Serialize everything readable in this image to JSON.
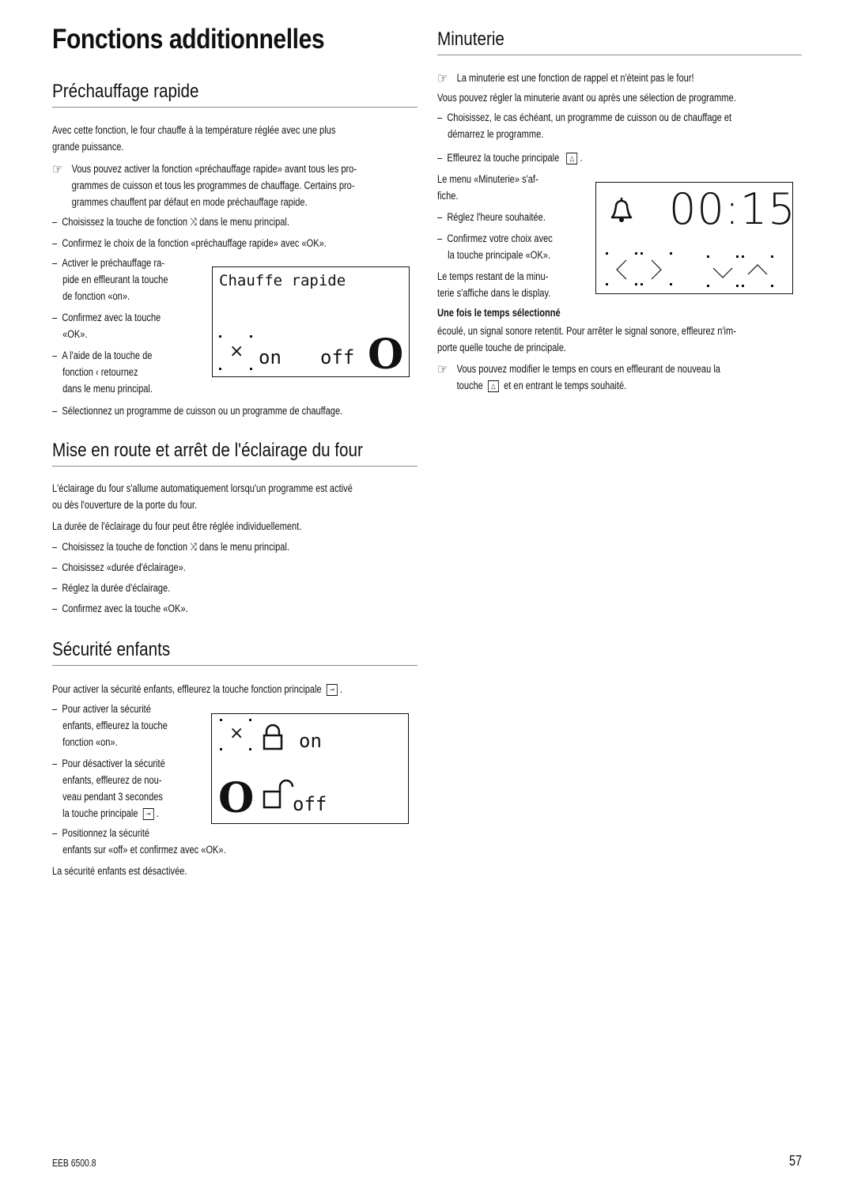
{
  "page": {
    "title": "Fonctions additionnelles",
    "footer_model": "EEB 6500.8",
    "page_number": "57"
  },
  "prechauffage": {
    "heading": "Préchauffage rapide",
    "intro": [
      "Avec cette fonction, le four chauffe à la température réglée avec une plus",
      "grande puissance."
    ],
    "note": [
      "Vous pouvez activer la fonction «préchauffage rapide» avant tous les pro-",
      "grammes de cuisson et tous les programmes de chauffage. Certains pro-",
      "grammes chauffent par défaut en mode préchauffage rapide."
    ],
    "steps": [
      "Choisissez la touche de fonction  ⤨  dans le menu principal.",
      "Confirmez le choix de la fonction «préchauffage rapide» avec «OK»."
    ],
    "steps_narrow": [
      [
        "Activer le préchauffage ra-",
        "pide en effleurant la touche",
        "de fonction «on»."
      ],
      [
        "Confirmez avec la touche",
        "«OK»."
      ],
      [
        "A l'aide de la touche de",
        "fonction  ‹  retournez",
        "dans le menu principal."
      ]
    ],
    "step_last": "Sélectionnez un programme de cuisson ou un programme de chauffage.",
    "lcd": {
      "label": "Chauffe rapide",
      "on": "on",
      "off": "off",
      "state": "O"
    }
  },
  "eclairage": {
    "heading": "Mise en route et arrêt de l'éclairage du four",
    "intro": [
      "L'éclairage du four s'allume automatiquement lorsqu'un programme est activé",
      "ou dès l'ouverture de la porte du four."
    ],
    "duration": "La durée de l'éclairage du four peut être réglée individuellement.",
    "steps": [
      "Choisissez la touche de fonction  ⤨  dans le menu principal.",
      "Choisissez «durée d'éclairage».",
      "Réglez la durée d'éclairage.",
      "Confirmez avec la touche «OK»."
    ]
  },
  "securite": {
    "heading": "Sécurité enfants",
    "intro": "Pour activer la sécurité enfants, effleurez la touche fonction principale",
    "steps": [
      [
        "Pour activer la sécurité",
        "enfants, effleurez la touche",
        "fonction «on»."
      ],
      [
        "Pour désactiver la sécurité",
        "enfants, effleurez de nou-",
        "veau pendant 3 secondes",
        "la touche principale"
      ],
      [
        "Positionnez la sécurité",
        "enfants sur «off» et confirmez avec «OK»."
      ]
    ],
    "outro": "La sécurité enfants est désactivée.",
    "lcd": {
      "on": "on",
      "off": "off",
      "state": "O"
    },
    "key_icon": "key-icon"
  },
  "minuterie": {
    "heading": "Minuterie",
    "note": "La minuterie est une fonction de rappel et n'éteint pas le four!",
    "intro": "Vous pouvez régler la minuterie avant ou après une sélection de programme.",
    "step1": [
      "Choisissez, le cas échéant, un programme de cuisson ou de chauffage et",
      "démarrez le programme."
    ],
    "step2": "Effleurez la touche principale",
    "menu_text": [
      "Le menu «Minuterie» s'af-",
      "fiche."
    ],
    "step3": "Réglez l'heure souhaitée.",
    "step4": [
      "Confirmez votre choix avec",
      "la touche principale «OK»."
    ],
    "remaining": [
      "Le temps restant de la minu-",
      "terie s'affiche dans le display."
    ],
    "finished_title": "Une fois le temps sélectionné",
    "finished": [
      "écoulé, un signal sonore retentit. Pour arrêter le signal sonore, effleurez n'im-",
      "porte quelle touche de principale."
    ],
    "note2": [
      "Vous pouvez modifier le temps en cours en effleurant de nouveau la",
      "touche",
      "et en entrant le temps souhaité."
    ],
    "lcd": {
      "time": "00:15"
    },
    "bell_icon": "bell-icon"
  }
}
